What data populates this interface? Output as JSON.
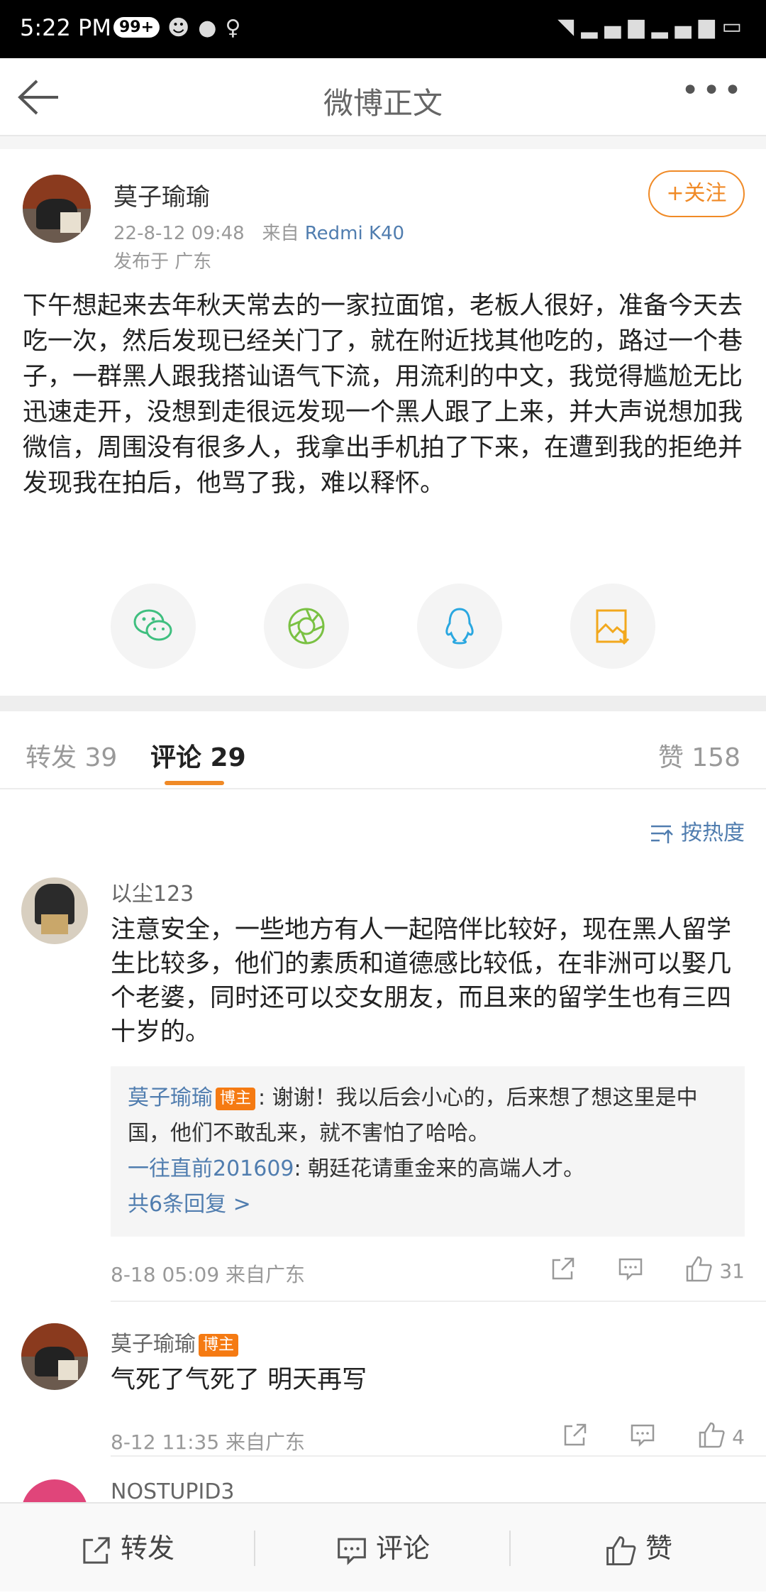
{
  "status_bar": {
    "time": "5:22 PM",
    "badge": "99+"
  },
  "nav": {
    "title": "微博正文"
  },
  "post": {
    "author": "莫子瑜瑜",
    "date": "22-8-12 09:48",
    "source_prefix": "来自",
    "source": "Redmi K40",
    "location": "发布于 广东",
    "follow_label": "+关注",
    "content": "下午想起来去年秋天常去的一家拉面馆，老板人很好，准备今天去吃一次，然后发现已经关门了，就在附近找其他吃的，路过一个巷子，一群黑人跟我搭讪语气下流，用流利的中文，我觉得尴尬无比迅速走开，没想到走很远发现一个黑人跟了上来，并大声说想加我微信，周围没有很多人，我拿出手机拍了下来，在遭到我的拒绝并发现我在拍后，他骂了我，难以释怀。"
  },
  "share_icons": [
    "wechat-icon",
    "moments-icon",
    "qq-icon",
    "save-image-icon"
  ],
  "tabs": {
    "repost": "转发 39",
    "comment": "评论 29",
    "like": "赞 158"
  },
  "sort_label": "按热度",
  "comments": [
    {
      "user": "以尘123",
      "text": "注意安全，一些地方有人一起陪伴比较好，现在黑人留学生比较多，他们的素质和道德感比较低，在非洲可以娶几个老婆，同时还可以交女朋友，而且来的留学生也有三四十岁的。",
      "replies": [
        {
          "user": "莫子瑜瑜",
          "tag": "博主",
          "text": ": 谢谢！我以后会小心的，后来想了想这里是中国，他们不敢乱来，就不害怕了哈哈。"
        },
        {
          "user": "一往直前201609",
          "text": ": 朝廷花请重金来的高端人才。"
        }
      ],
      "more_replies": "共6条回复 >",
      "time": "8-18 05:09 来自广东",
      "likes": "31"
    },
    {
      "user": "莫子瑜瑜",
      "tag": "博主",
      "text": "气死了气死了 明天再写",
      "time": "8-12 11:35 来自广东",
      "likes": "4"
    },
    {
      "user": "NOSTUPID3"
    }
  ],
  "bottom_bar": {
    "repost": "转发",
    "comment": "评论",
    "like": "赞"
  },
  "colors": {
    "accent": "#f08a26",
    "link": "#507daf",
    "tag": "#f57a12"
  }
}
